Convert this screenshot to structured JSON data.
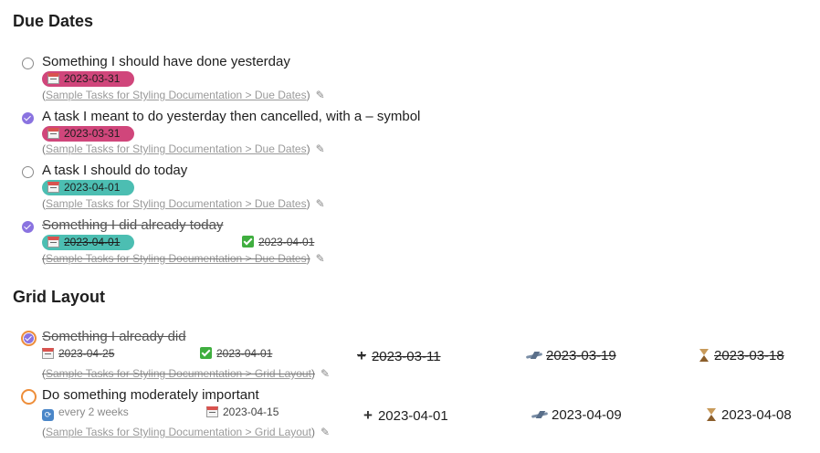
{
  "sections": {
    "due": {
      "title": "Due Dates",
      "backlink_text": "Sample Tasks for Styling Documentation > Due Dates",
      "tasks": [
        {
          "description": "Something I should have done yesterday",
          "due": "2023-03-31"
        },
        {
          "description": "A task I meant to do yesterday then cancelled, with a  –  symbol",
          "due": "2023-03-31"
        },
        {
          "description": "A task I should do today",
          "due": "2023-04-01"
        },
        {
          "description": "Something I did already today",
          "due": "2023-04-01",
          "done": "2023-04-01"
        }
      ]
    },
    "grid": {
      "title": "Grid Layout",
      "backlink_text": "Sample Tasks for Styling Documentation > Grid Layout",
      "tasks": [
        {
          "description": "Something I already did",
          "due": "2023-04-25",
          "done": "2023-04-01",
          "created": "2023-03-11",
          "start": "2023-03-19",
          "scheduled": "2023-03-18"
        },
        {
          "description": "Do something moderately important",
          "recurrence": "every 2 weeks",
          "due": "2023-04-15",
          "created": "2023-04-01",
          "start": "2023-04-09",
          "scheduled": "2023-04-08"
        }
      ]
    }
  },
  "backlink_open": "(",
  "backlink_close": ")",
  "icons": {
    "checkbox": "circle-checkbox-icon",
    "due": "calendar-icon",
    "done": "check-mark-button-icon",
    "created": "plus-icon",
    "start": "airplane-departure-icon",
    "scheduled": "hourglass-icon",
    "recurrence": "repeat-icon",
    "edit": "pencil-icon"
  },
  "colors": {
    "overdue_pill": "#d0467b",
    "today_pill": "#4cbeb2",
    "checked": "#8a73e0",
    "priority_ring": "#ee8e3a"
  }
}
